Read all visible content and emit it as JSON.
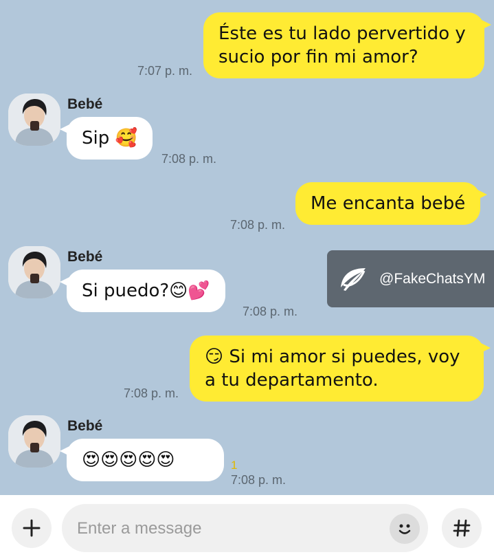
{
  "messages": [
    {
      "id": "m1",
      "direction": "sent",
      "text": "Éste es tu lado pervertido y sucio por fin mi amor?",
      "time": "7:07 p. m."
    },
    {
      "id": "m2",
      "direction": "received",
      "sender": "Bebé",
      "text": "Sip 🥰",
      "time": "7:08 p. m."
    },
    {
      "id": "m3",
      "direction": "sent",
      "text": "Me encanta bebé",
      "time": "7:08 p. m."
    },
    {
      "id": "m4",
      "direction": "received",
      "sender": "Bebé",
      "text": "Si puedo?😊💕",
      "time": "7:08 p. m."
    },
    {
      "id": "m5",
      "direction": "sent",
      "text": "😏 Si mi amor si puedes, voy a tu departamento.",
      "time": "7:08 p. m."
    },
    {
      "id": "m6",
      "direction": "received",
      "sender": "Bebé",
      "text": "😍😍😍😍😍",
      "time": "7:08 p. m.",
      "unread_count": "1"
    }
  ],
  "watermark": {
    "text": "@FakeChatsYM",
    "icon": "leaf-icon"
  },
  "composer": {
    "placeholder": "Enter a message",
    "add_icon": "plus-icon",
    "emoji_icon": "smiley-icon",
    "hash_icon": "hash-icon"
  },
  "colors": {
    "background": "#b2c7da",
    "sent_bubble": "#ffeb33",
    "received_bubble": "#ffffff",
    "watermark_bg": "#5e6770"
  }
}
